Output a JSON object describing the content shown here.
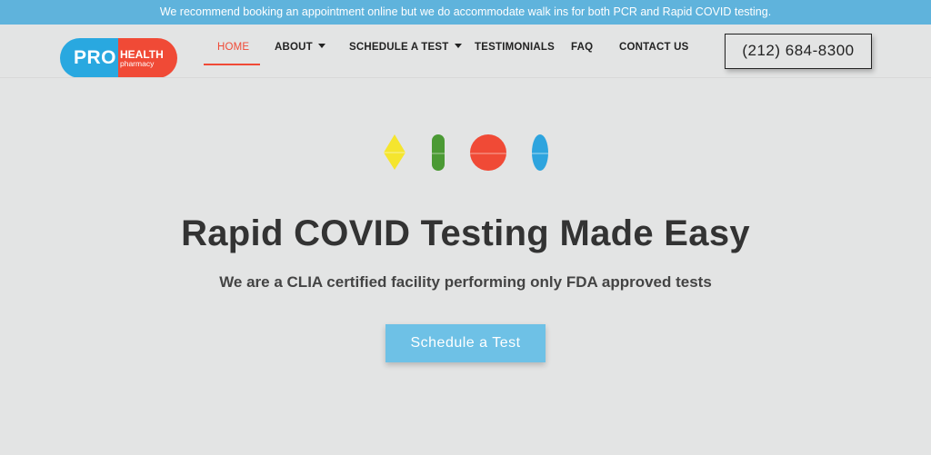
{
  "announcement": "We recommend booking an appointment online but we do accommodate walk ins for both PCR and Rapid COVID testing.",
  "logo": {
    "pro": "PRO",
    "health": "HEALTH",
    "pharmacy": "pharmacy"
  },
  "nav": {
    "home": "HOME",
    "about": "ABOUT",
    "schedule": "SCHEDULE A TEST",
    "testimonials": "TESTIMONIALS",
    "faq": "FAQ",
    "contact": "CONTACT US"
  },
  "phone": "(212) 684-8300",
  "hero": {
    "title": "Rapid COVID Testing Made Easy",
    "subtitle": "We are a CLIA certified facility performing only FDA approved tests",
    "cta": "Schedule a Test"
  },
  "colors": {
    "accent_blue": "#5fb3dc",
    "brand_red": "#f04a36",
    "pill_yellow": "#f5e52e",
    "pill_green": "#4b9a34",
    "pill_blue": "#2ea4de"
  },
  "icons": [
    "diamond-pill-icon",
    "capsule-pill-icon",
    "round-pill-icon",
    "oval-pill-icon"
  ]
}
